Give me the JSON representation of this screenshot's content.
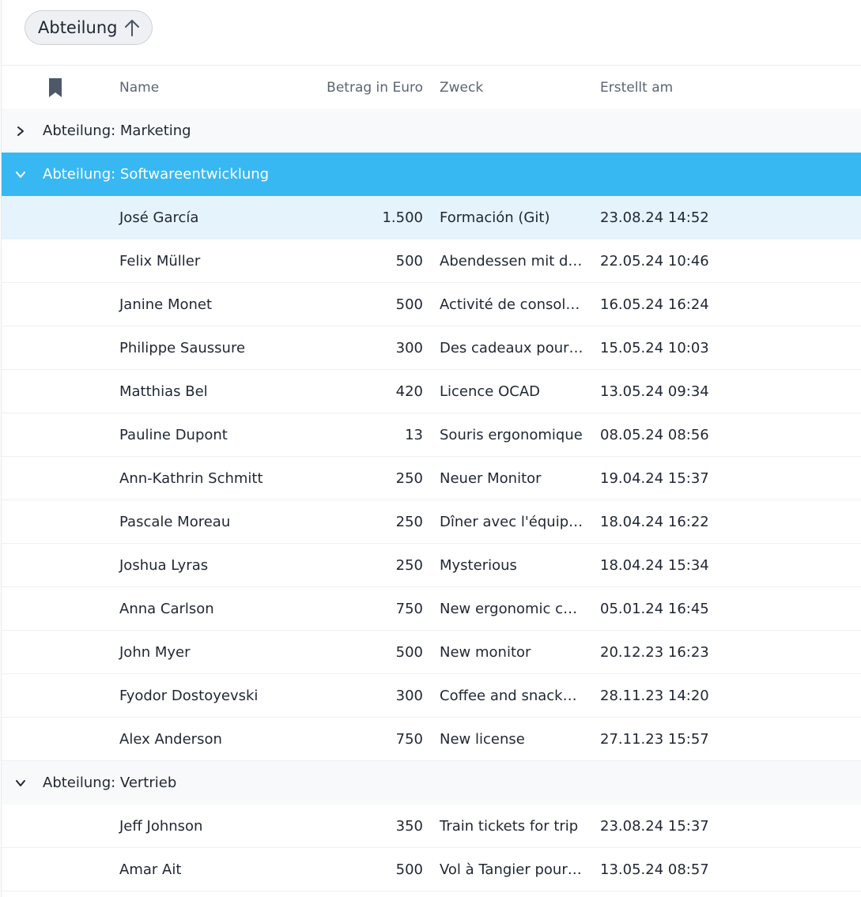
{
  "toolbar": {
    "group_chip_label": "Abteilung",
    "group_chip_icon": "arrow-up-icon"
  },
  "columns": {
    "bookmark_icon": "bookmark-icon",
    "name": "Name",
    "amount": "Betrag in Euro",
    "purpose": "Zweck",
    "created": "Erstellt am"
  },
  "groups": [
    {
      "label": "Abteilung: Marketing",
      "expanded": false,
      "rows": []
    },
    {
      "label": "Abteilung: Softwareentwicklung",
      "expanded": true,
      "selected": true,
      "rows": [
        {
          "name": "José García",
          "amount": "1.500",
          "purpose": "Formación (Git)",
          "created": "23.08.24 14:52"
        },
        {
          "name": "Felix Müller",
          "amount": "500",
          "purpose": "Abendessen mit dem Team",
          "created": "22.05.24 10:46"
        },
        {
          "name": "Janine Monet",
          "amount": "500",
          "purpose": "Activité de consolidation d'équipe",
          "created": "16.05.24 16:24"
        },
        {
          "name": "Philippe Saussure",
          "amount": "300",
          "purpose": "Des cadeaux pour l'équipe",
          "created": "15.05.24 10:03"
        },
        {
          "name": "Matthias Bel",
          "amount": "420",
          "purpose": "Licence OCAD",
          "created": "13.05.24 09:34"
        },
        {
          "name": "Pauline Dupont",
          "amount": "13",
          "purpose": "Souris ergonomique",
          "created": "08.05.24 08:56"
        },
        {
          "name": "Ann-Kathrin Schmitt",
          "amount": "250",
          "purpose": "Neuer Monitor",
          "created": "19.04.24 15:37"
        },
        {
          "name": "Pascale Moreau",
          "amount": "250",
          "purpose": "Dîner avec l'équipe de développement",
          "created": "18.04.24 16:22"
        },
        {
          "name": "Joshua Lyras",
          "amount": "250",
          "purpose": "Mysterious",
          "created": "18.04.24 15:34"
        },
        {
          "name": "Anna Carlson",
          "amount": "750",
          "purpose": "New ergonomic chair",
          "created": "05.01.24 16:45"
        },
        {
          "name": "John Myer",
          "amount": "500",
          "purpose": "New monitor",
          "created": "20.12.23 16:23"
        },
        {
          "name": "Fyodor Dostoyevski",
          "amount": "300",
          "purpose": "Coffee and snacks for the team",
          "created": "28.11.23 14:20"
        },
        {
          "name": "Alex Anderson",
          "amount": "750",
          "purpose": "New license",
          "created": "27.11.23 15:57"
        }
      ]
    },
    {
      "label": "Abteilung: Vertrieb",
      "expanded": true,
      "rows": [
        {
          "name": "Jeff Johnson",
          "amount": "350",
          "purpose": "Train tickets for trip",
          "created": "23.08.24 15:37"
        },
        {
          "name": "Amar Ait",
          "amount": "500",
          "purpose": "Vol à Tangier pour conférence",
          "created": "13.05.24 08:57"
        }
      ]
    }
  ],
  "colors": {
    "selected_group": "#38b8f2",
    "hover_row": "#e5f3fd",
    "group_row": "#f8f9fa"
  }
}
